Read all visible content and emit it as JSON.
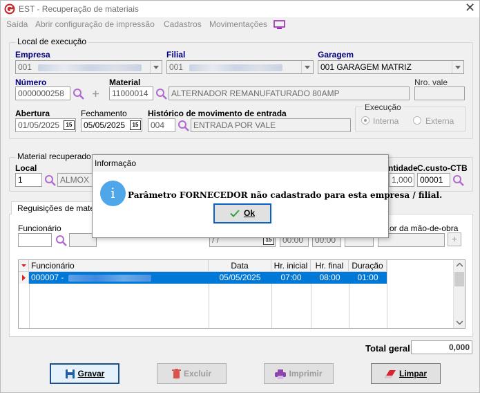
{
  "window": {
    "title": "EST - Recuperação de materiais",
    "close": "✕"
  },
  "menu": {
    "items": [
      "Saída",
      "Abrir configuração de impressão",
      "Cadastros",
      "Movimentações"
    ]
  },
  "local_execucao": {
    "group_title": "Local de execução",
    "empresa": {
      "label": "Empresa",
      "value": "001"
    },
    "filial": {
      "label": "Filial",
      "value": "001"
    },
    "garagem": {
      "label": "Garagem",
      "value": "001 GARAGEM MATRIZ"
    },
    "numero": {
      "label": "Número",
      "value": "0000000258"
    },
    "material": {
      "label": "Material",
      "code": "11000014",
      "desc": "ALTERNADOR REMANUFATURADO 80AMP"
    },
    "nro_vale": {
      "label": "Nro. vale",
      "value": ""
    },
    "abertura": {
      "label": "Abertura",
      "value": "01/05/2025"
    },
    "fechamento": {
      "label": "Fechamento",
      "value": "05/05/2025"
    },
    "historico": {
      "label": "Histórico de movimento de entrada",
      "code": "004",
      "desc": "ENTRADA POR VALE"
    },
    "execucao": {
      "title": "Execução",
      "interna": "Interna",
      "externa": "Externa",
      "selected": "Interna"
    },
    "cal_icon": "15"
  },
  "material_recuperado": {
    "group_title": "Material recuperado",
    "local": {
      "label": "Local",
      "code": "1",
      "desc": "ALMOX M"
    },
    "quantidade": {
      "label": "ntidade",
      "value": "1,000"
    },
    "ccusto": {
      "label": "C.custo-CTB",
      "value": "00001"
    }
  },
  "requisicoes": {
    "tab_label": "Reguisições de materia",
    "funcionario_label": "Funcionário",
    "mao_obra_label": "or da mão-de-obra",
    "date_value": "/ /",
    "time1": "00:00",
    "time2": "00:00",
    "add": "+",
    "grid": {
      "headers": [
        "Funcionário",
        "Data",
        "Hr. inicial",
        "Hr. final",
        "Duração"
      ],
      "rows": [
        {
          "funcionario": "000007 -",
          "data": "05/05/2025",
          "hr_inicial": "07:00",
          "hr_final": "08:00",
          "duracao": "01:00"
        }
      ]
    }
  },
  "total": {
    "label": "Total geral",
    "value": "0,000"
  },
  "buttons": {
    "gravar": "Gravar",
    "excluir": "Excluir",
    "imprimir": "Imprimir",
    "limpar": "Limpar"
  },
  "dialog": {
    "title": "Informação",
    "message": "Parâmetro FORNECEDOR não cadastrado para esta empresa / filial.",
    "ok": "Ok",
    "icon_glyph": "i"
  },
  "colors": {
    "accent": "#0078d7",
    "label_blue": "#000080",
    "info_icon": "#4fa6e8",
    "brand_red": "#c0282d"
  }
}
